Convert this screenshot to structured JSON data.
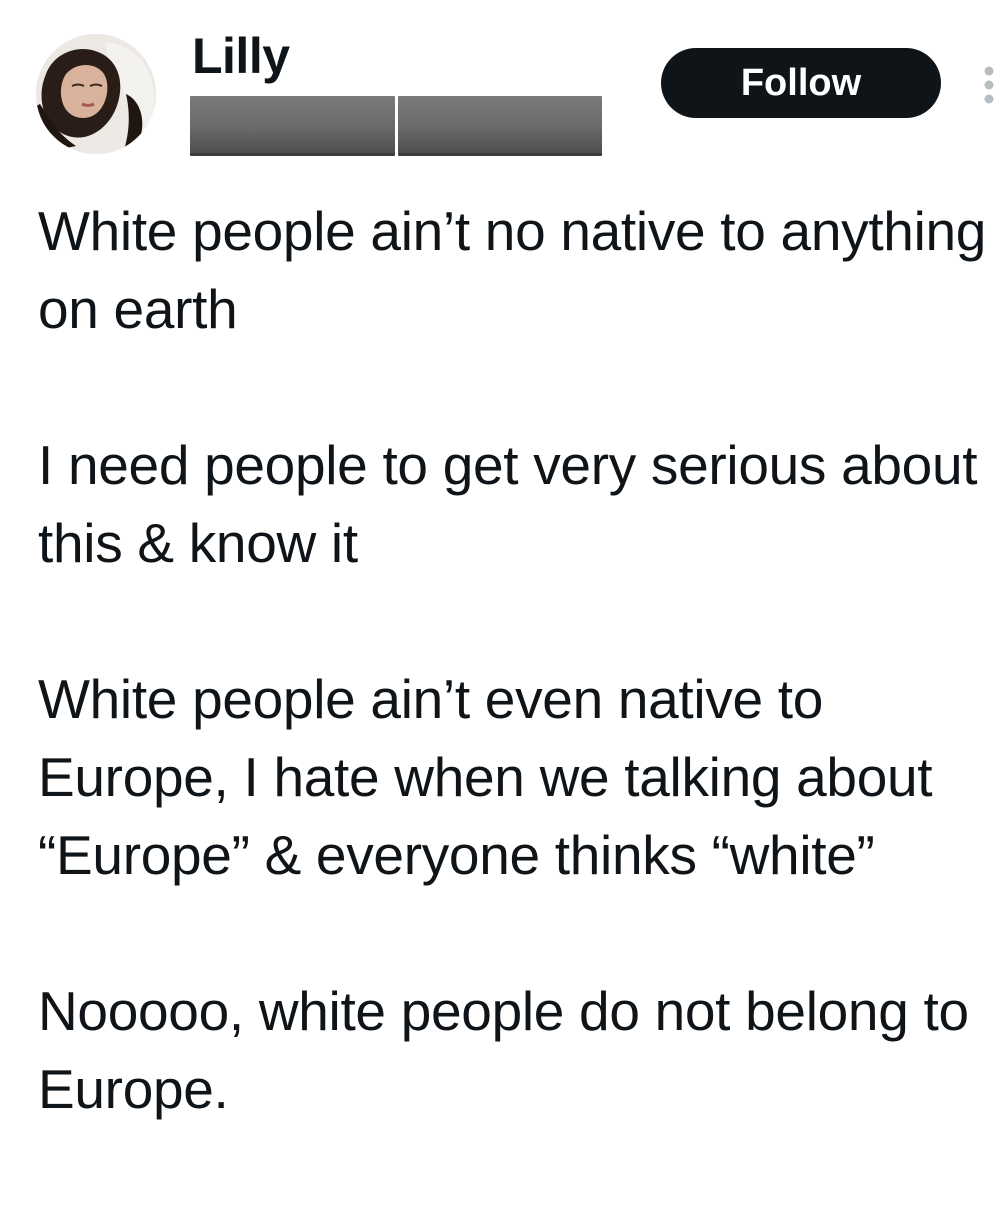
{
  "author": {
    "display_name": "Lilly",
    "avatar_icon": "profile-photo",
    "handle_redacted": true
  },
  "actions": {
    "follow_label": "Follow",
    "more_icon": "more-vertical-icon"
  },
  "tweet": {
    "paragraphs": [
      "White people ain’t no native to anything on earth",
      "I need people to get very serious about this & know it",
      "White people ain’t even native to Europe, I hate when we talking about “Europe” & everyone thinks “white”",
      "Nooooo, white people do not belong to Europe."
    ]
  },
  "colors": {
    "text": "#0f1419",
    "follow_bg": "#0f1419",
    "follow_text": "#ffffff",
    "redaction": "#6a6a6a",
    "more_icon": "#b7bcc1"
  }
}
